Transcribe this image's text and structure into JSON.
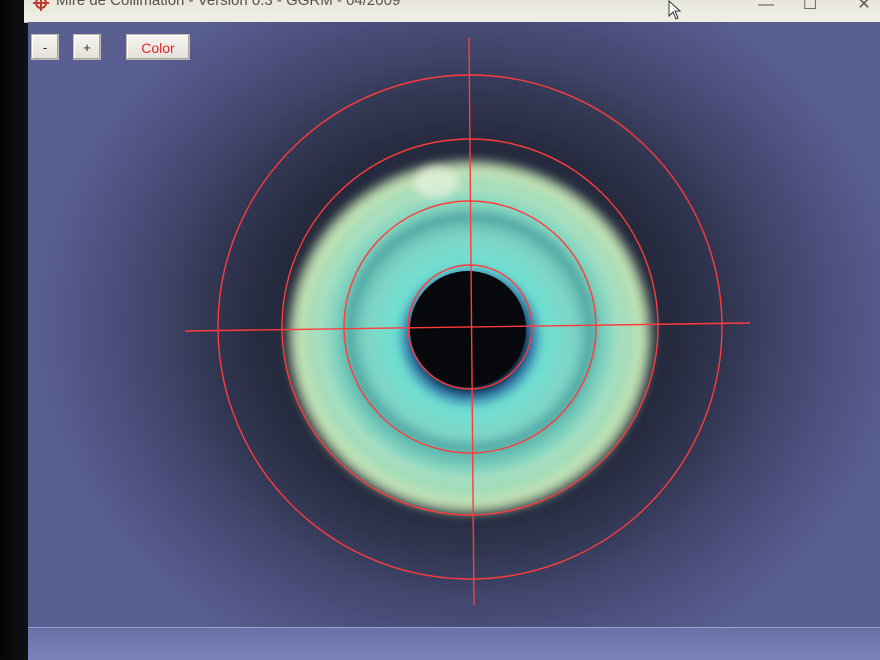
{
  "window": {
    "title": "Mire de Collimation - Version 0.3 - GGRM - 04/2009",
    "controls": {
      "minimize": "—",
      "maximize": "☐",
      "close": "✕"
    }
  },
  "toolbar": {
    "zoom_out_label": "-",
    "zoom_in_label": "+",
    "color_label": "Color"
  },
  "reticle": {
    "color": "#ff3b3b",
    "circle_count": 4,
    "crosshair": true
  },
  "colors": {
    "iris": "#6fd0c0",
    "pupil": "#0a0c10",
    "background": "#2e3246",
    "accent_text": "#e0282c"
  },
  "icons": {
    "app": "app-icon",
    "cursor": "mouse-cursor-icon"
  }
}
